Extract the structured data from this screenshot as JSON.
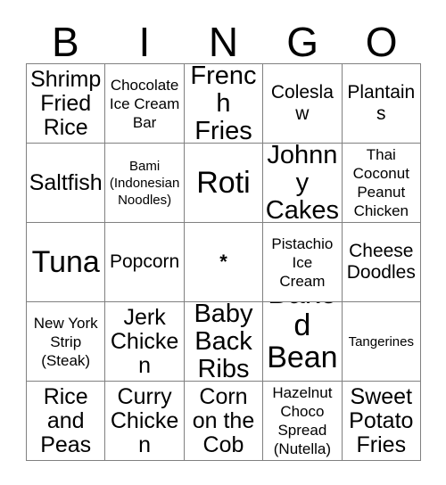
{
  "card": {
    "title_letters": [
      "B",
      "I",
      "N",
      "G",
      "O"
    ],
    "free_space_marker": "*",
    "grid": [
      [
        {
          "text": "Shrimp\nFried\nRice",
          "size": "l"
        },
        {
          "text": "Chocolate\nIce Cream\nBar",
          "size": "s"
        },
        {
          "text": "French\nFries",
          "size": "xl"
        },
        {
          "text": "Coleslaw",
          "size": "m"
        },
        {
          "text": "Plantains",
          "size": "m"
        }
      ],
      [
        {
          "text": "Saltfish",
          "size": "l"
        },
        {
          "text": "Bami\n(Indonesian\nNoodles)",
          "size": "xs"
        },
        {
          "text": "Roti",
          "size": "xxl"
        },
        {
          "text": "Johnny\nCakes",
          "size": "xl"
        },
        {
          "text": "Thai\nCoconut\nPeanut\nChicken",
          "size": "s"
        }
      ],
      [
        {
          "text": "Tuna",
          "size": "xxl"
        },
        {
          "text": "Popcorn",
          "size": "m"
        },
        {
          "text": "*",
          "size": "free"
        },
        {
          "text": "Pistachio\nIce\nCream",
          "size": "s"
        },
        {
          "text": "Cheese\nDoodles",
          "size": "m"
        }
      ],
      [
        {
          "text": "New York\nStrip\n(Steak)",
          "size": "s"
        },
        {
          "text": "Jerk\nChicken",
          "size": "l"
        },
        {
          "text": "Baby\nBack\nRibs",
          "size": "xl"
        },
        {
          "text": "Baked\nBeans",
          "size": "xxl"
        },
        {
          "text": "Tangerines",
          "size": "xs"
        }
      ],
      [
        {
          "text": "Rice\nand\nPeas",
          "size": "l"
        },
        {
          "text": "Curry\nChicken",
          "size": "l"
        },
        {
          "text": "Corn\non the\nCob",
          "size": "l"
        },
        {
          "text": "Hazelnut\nChoco\nSpread\n(Nutella)",
          "size": "s"
        },
        {
          "text": "Sweet\nPotato\nFries",
          "size": "l"
        }
      ]
    ]
  },
  "colors": {
    "background": "#ffffff",
    "text": "#000000",
    "grid_line": "#808080"
  }
}
